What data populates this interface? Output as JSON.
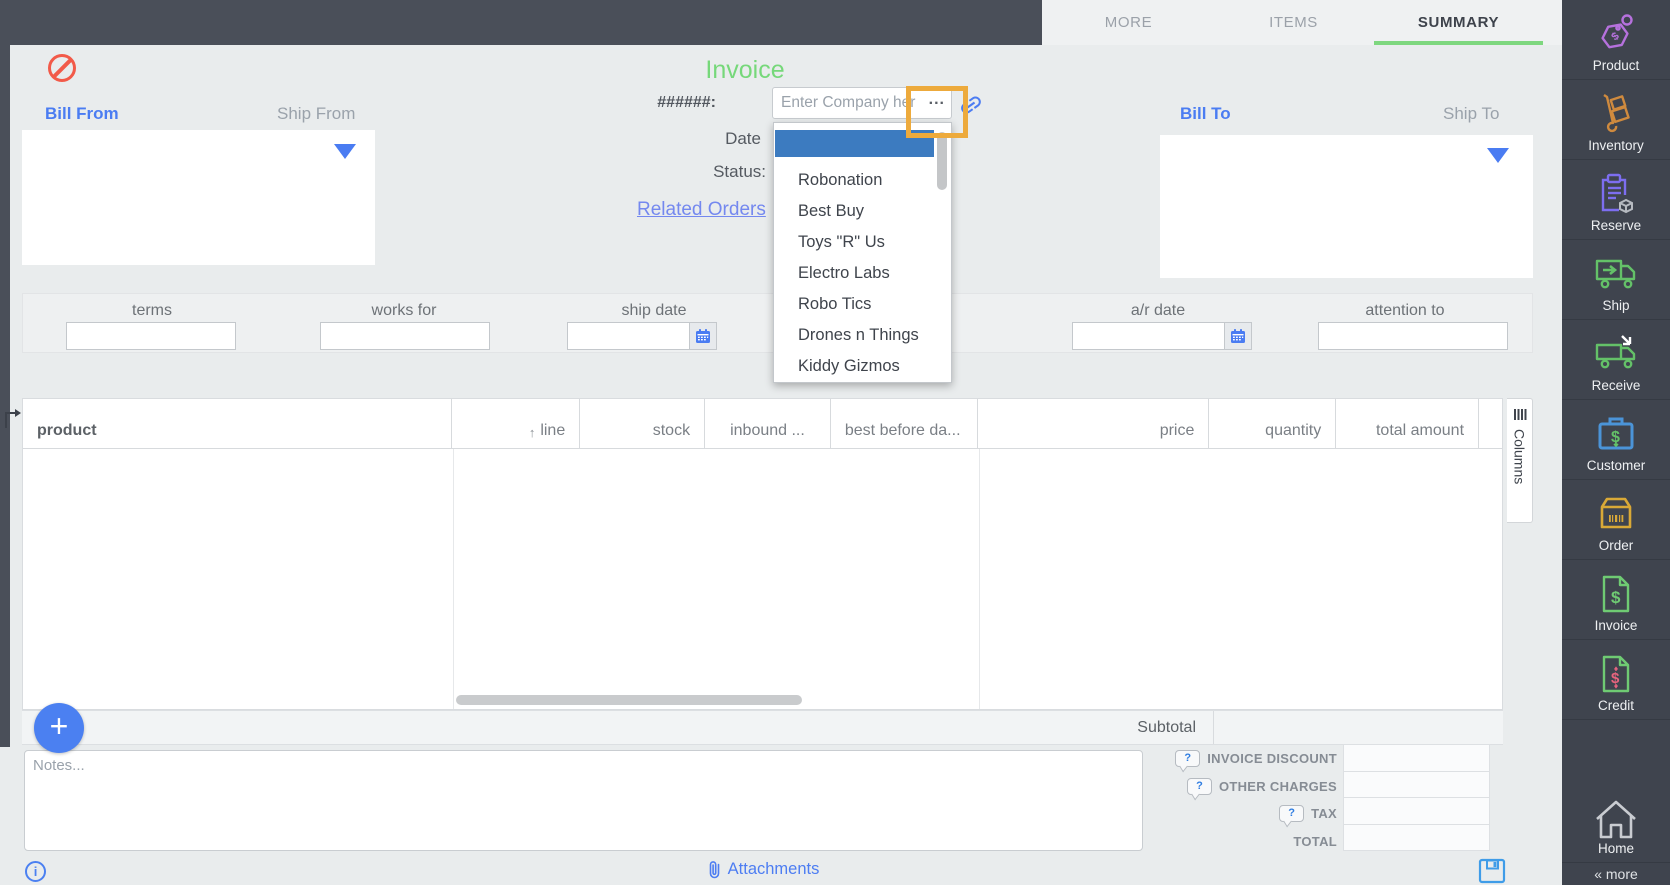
{
  "tabs": {
    "more": "MORE",
    "items": "ITEMS",
    "summary": "SUMMARY"
  },
  "header": {
    "title": "Invoice",
    "number_label": "######:",
    "company_placeholder": "Enter Company her",
    "more_button": "...",
    "date_label": "Date",
    "status_label": "Status:",
    "related_link": "Related Orders"
  },
  "company_dropdown": {
    "options": [
      "Robonation",
      "Best Buy",
      "Toys \"R\" Us",
      "Electro Labs",
      "Robo Tics",
      "Drones n Things",
      "Kiddy Gizmos"
    ]
  },
  "parties": {
    "bill_from": "Bill From",
    "ship_from": "Ship From",
    "bill_to": "Bill To",
    "ship_to": "Ship To"
  },
  "details": {
    "terms": "terms",
    "works_for": "works for",
    "ship_date": "ship date",
    "ar_date": "a/r date",
    "attention_to": "attention to"
  },
  "items_table": {
    "col_product": "product",
    "col_line": "line",
    "col_stock": "stock",
    "col_inbound": "inbound ...",
    "col_best_before": "best before da...",
    "col_price": "price",
    "col_quantity": "quantity",
    "col_total": "total amount",
    "sort_arrow": "↑",
    "columns_tab": "Columns"
  },
  "totals": {
    "subtotal_label": "Subtotal",
    "invoice_discount": "INVOICE DISCOUNT",
    "other_charges": "OTHER CHARGES",
    "tax": "TAX",
    "total": "TOTAL",
    "help_glyph": "?"
  },
  "notes": {
    "placeholder": "Notes..."
  },
  "footer": {
    "attachments": "Attachments",
    "info_glyph": "i"
  },
  "fab": {
    "plus": "+"
  },
  "sidebar": {
    "product": "Product",
    "inventory": "Inventory",
    "reserve": "Reserve",
    "ship": "Ship",
    "receive": "Receive",
    "customer": "Customer",
    "order": "Order",
    "invoice": "Invoice",
    "credit": "Credit",
    "home": "Home",
    "more": "« more"
  },
  "colors": {
    "accent_blue": "#4a7cf2",
    "title_green": "#76d87a",
    "tab_underline_green": "#7ed77f",
    "selection_blue": "#3c7bc0",
    "highlight_orange": "#edaa3c",
    "prohibited_red": "#f25a49",
    "sidebar_bg": "#3f444e"
  }
}
